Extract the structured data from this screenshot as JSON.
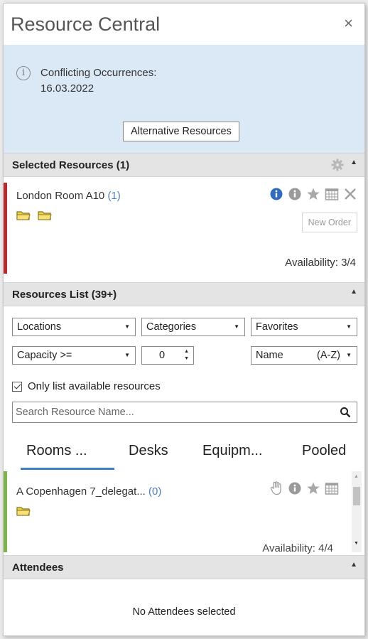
{
  "window": {
    "title": "Resource Central",
    "close_glyph": "×"
  },
  "conflict": {
    "label": "Conflicting Occurrences:",
    "date": "16.03.2022",
    "alt_button": "Alternative Resources"
  },
  "selected_section": {
    "title": "Selected Resources (1)",
    "resource": {
      "name": "London Room A10",
      "count": "(1)",
      "new_order": "New Order",
      "availability": "Availability: 3/4",
      "accent": "#c0272d"
    }
  },
  "list_section": {
    "title": "Resources List (39+)",
    "filters": {
      "locations": "Locations",
      "categories": "Categories",
      "favorites": "Favorites",
      "capacity": "Capacity >=",
      "capacity_value": "0",
      "sort_name": "Name",
      "sort_order": "(A-Z)",
      "only_available": "Only list available resources",
      "search_placeholder": "Search Resource Name..."
    },
    "tabs": [
      {
        "label": "Rooms ..."
      },
      {
        "label": "Desks"
      },
      {
        "label": "Equipm..."
      },
      {
        "label": "Pooled"
      }
    ],
    "item": {
      "name": "A Copenhagen 7_delegat...",
      "count": "(0)",
      "availability": "Availability: 4/4",
      "accent": "#7bb547"
    }
  },
  "attendees_section": {
    "title": "Attendees",
    "empty": "No Attendees selected"
  },
  "colors": {
    "info_bg": "#dbe8f5",
    "header_bg": "#e4e4e4",
    "accent_blue": "#3f7fc8",
    "link_blue": "#4a7fc1",
    "folder": "#f2d34a"
  }
}
